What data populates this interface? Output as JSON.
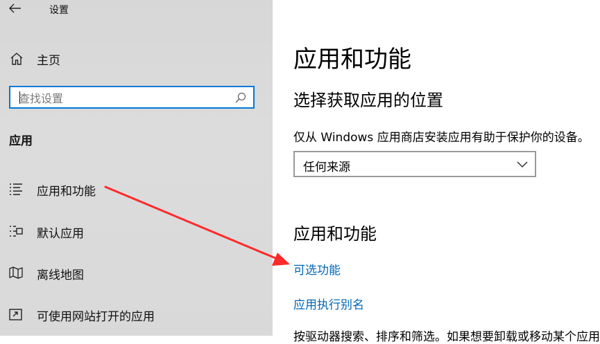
{
  "window": {
    "title": "设置"
  },
  "sidebar": {
    "home_label": "主页",
    "search_placeholder": "查找设置",
    "section_title": "应用",
    "items": [
      {
        "label": "应用和功能",
        "icon": "apps-list-icon"
      },
      {
        "label": "默认应用",
        "icon": "default-apps-icon"
      },
      {
        "label": "离线地图",
        "icon": "map-icon"
      },
      {
        "label": "可使用网站打开的应用",
        "icon": "open-app-icon"
      }
    ]
  },
  "main": {
    "page_title": "应用和功能",
    "install_heading": "选择获取应用的位置",
    "install_desc": "仅从 Windows 应用商店安装应用有助于保护你的设备。",
    "source_dropdown_value": "任何来源",
    "apps_heading": "应用和功能",
    "links": [
      "可选功能",
      "应用执行别名"
    ],
    "truncated_text": "按驱动器搜索、排序和筛选。如果想要卸载或移动某个应用"
  },
  "colors": {
    "accent": "#0078d7",
    "link": "#0067b8",
    "annotation_arrow": "#ff2a2a"
  }
}
